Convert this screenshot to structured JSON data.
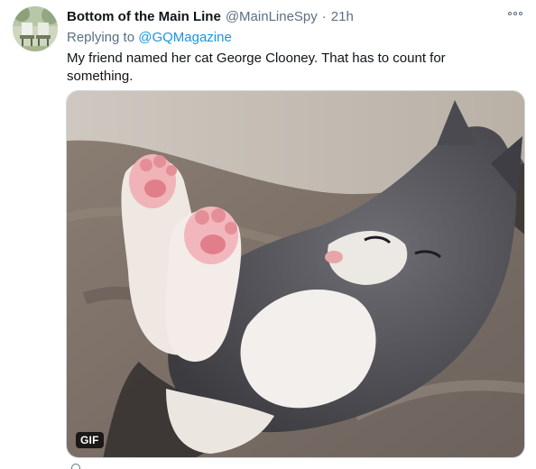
{
  "tweet": {
    "display_name": "Bottom of the Main Line",
    "handle": "@MainLineSpy",
    "separator": "·",
    "time": "21h",
    "replying_prefix": "Replying to",
    "replying_to": "@GQMagazine",
    "text": "My friend named her cat George Clooney. That has to count for something.",
    "media": {
      "badge": "GIF",
      "icon": "kitten-gif"
    }
  },
  "icons": {
    "more": "more-horizontal-icon",
    "avatar": "avatar-image"
  },
  "colors": {
    "primary_text": "#0f1419",
    "secondary_text": "#5b7083",
    "link": "#1b95e0",
    "border": "#cfd9de"
  }
}
